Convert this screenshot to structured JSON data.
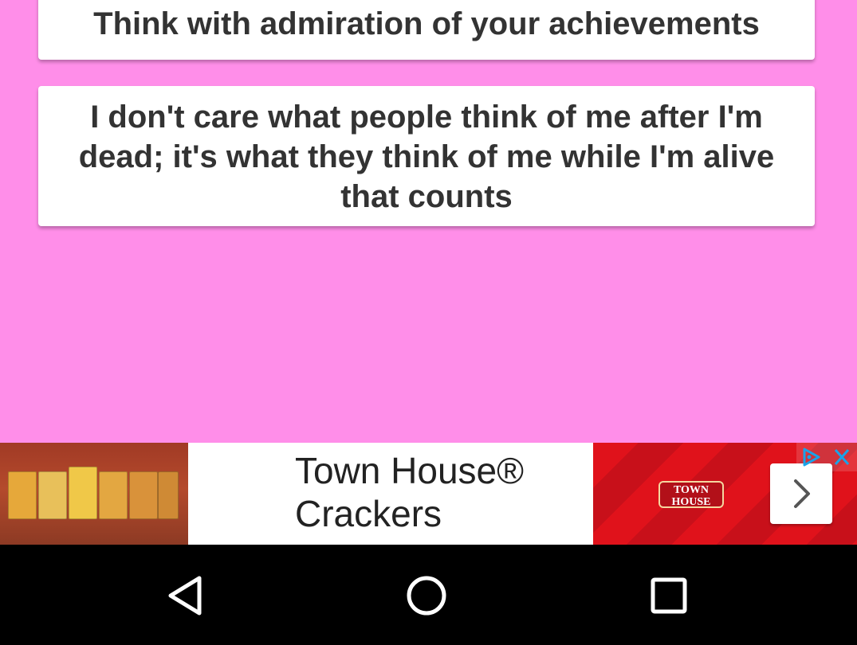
{
  "quotes": [
    {
      "text": "Think with admiration of your achievements"
    },
    {
      "text": "I don't care what people think of me after I'm dead; it's what they think of me while I'm alive that counts"
    }
  ],
  "ad": {
    "headline": "Town House® Crackers",
    "brand_logo_text": "TOWN HOUSE",
    "choices_icon": "ad-choices-icon",
    "close_icon": "close-icon",
    "next_icon": "chevron-right-icon"
  },
  "navbar": {
    "back_icon": "back-icon",
    "home_icon": "home-icon",
    "recents_icon": "recents-icon"
  },
  "colors": {
    "background": "#ff8ee9",
    "card": "#ffffff",
    "ad_red": "#e0121b",
    "navbar": "#000000"
  }
}
